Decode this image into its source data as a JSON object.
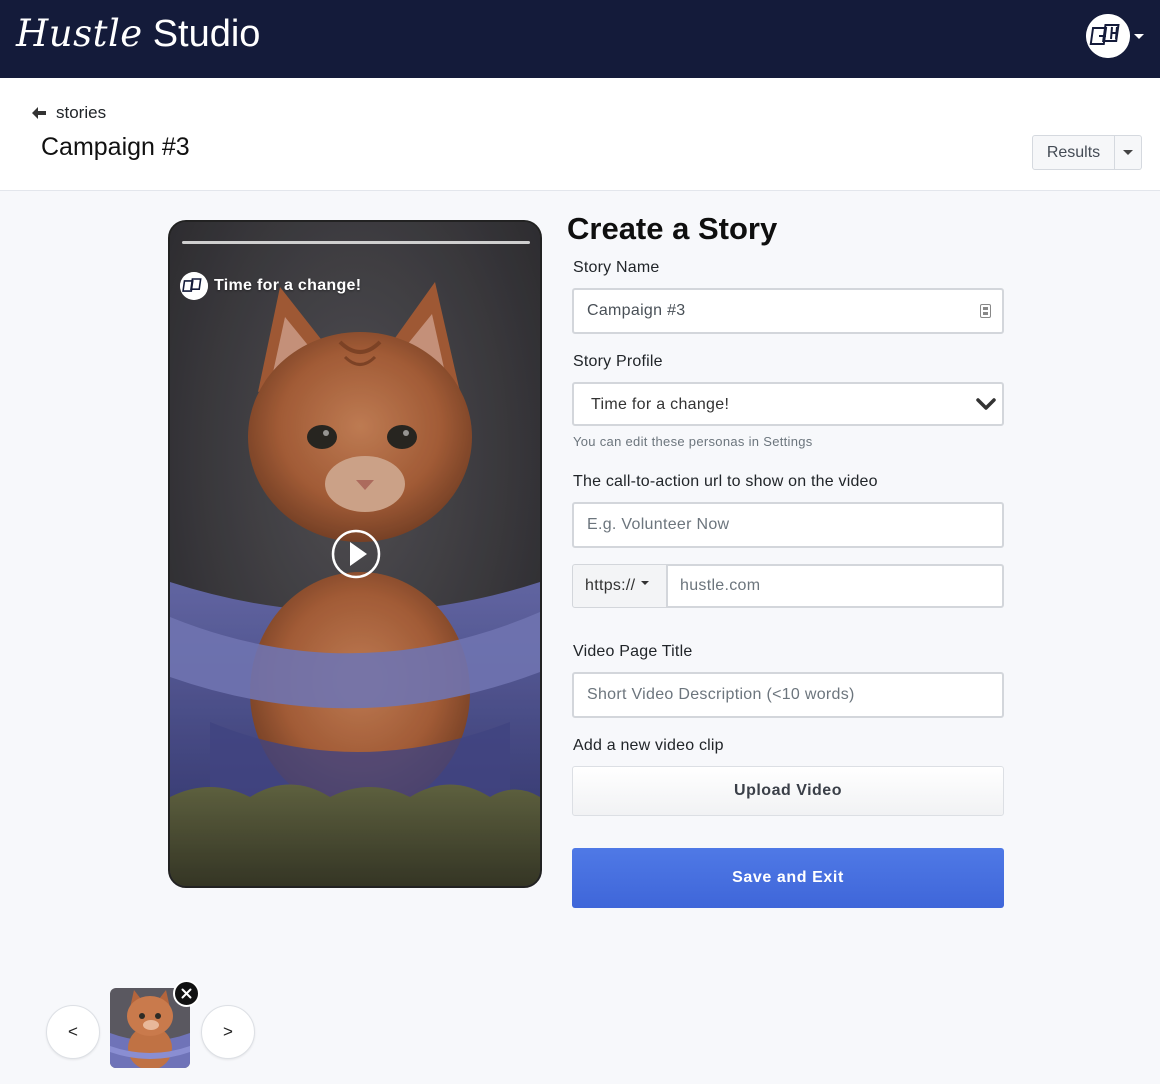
{
  "navbar": {
    "brand_italic": "Hustle",
    "brand_studio": "Studio",
    "avatar_icon": "hustle-logo-icon"
  },
  "header": {
    "back_label": "stories",
    "page_title": "Campaign #3",
    "results_label": "Results"
  },
  "preview": {
    "story_title": "Time for a change!",
    "play_icon": "play-icon"
  },
  "form": {
    "title": "Create a Story",
    "story_name_label": "Story Name",
    "story_name_value": "Campaign #3",
    "story_profile_label": "Story Profile",
    "story_profile_value": "Time for a change!",
    "story_profile_help": "You can edit these personas in Settings",
    "cta_label": "The call-to-action url to show on the video",
    "cta_text_placeholder": "E.g. Volunteer Now",
    "url_protocol": "https://",
    "url_placeholder": "hustle.com",
    "video_title_label": "Video Page Title",
    "video_title_placeholder": "Short Video Description (<10 words)",
    "clip_label": "Add a new video clip",
    "upload_label": "Upload Video",
    "save_label": "Save and Exit"
  },
  "clips": {
    "prev_label": "<",
    "next_label": ">",
    "remove_icon": "close-icon"
  },
  "colors": {
    "navbar": "#141b3a",
    "primary": "#4470df",
    "background": "#f7f8fb"
  }
}
